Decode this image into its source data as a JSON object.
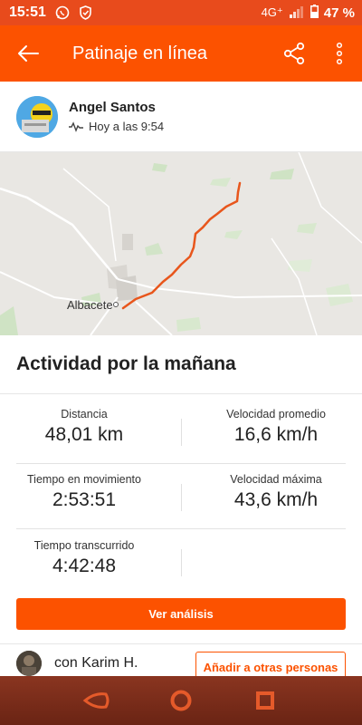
{
  "status_bar": {
    "time": "15:51",
    "network": "4G⁺",
    "battery": "47 %",
    "icons": [
      "whatsapp-icon",
      "shield-icon",
      "signal-icon",
      "battery-icon"
    ]
  },
  "app_bar": {
    "title": "Patinaje en línea",
    "icons": [
      "back-arrow-icon",
      "share-icon",
      "more-vert-icon"
    ]
  },
  "athlete": {
    "name": "Angel Santos",
    "time": "Hoy a las 9:54",
    "activity_icon": "activity-pulse-icon"
  },
  "map": {
    "city_label": "Albacete"
  },
  "activity": {
    "title": "Actividad por la mañana"
  },
  "stats": [
    {
      "label": "Distancia",
      "value": "48,01 km"
    },
    {
      "label": "Velocidad promedio",
      "value": "16,6 km/h"
    },
    {
      "label": "Tiempo en movimiento",
      "value": "2:53:51"
    },
    {
      "label": "Velocidad máxima",
      "value": "43,6 km/h"
    },
    {
      "label": "Tiempo transcurrido",
      "value": "4:42:48"
    }
  ],
  "buttons": {
    "analysis": "Ver análisis",
    "add_others": "Añadir a otras personas"
  },
  "with_others": {
    "text": "con Karim H."
  },
  "colors": {
    "brand": "#fc5200",
    "status_bar": "#e84b1c",
    "route": "#e8561c",
    "nav_bar": "#7a2c18"
  }
}
